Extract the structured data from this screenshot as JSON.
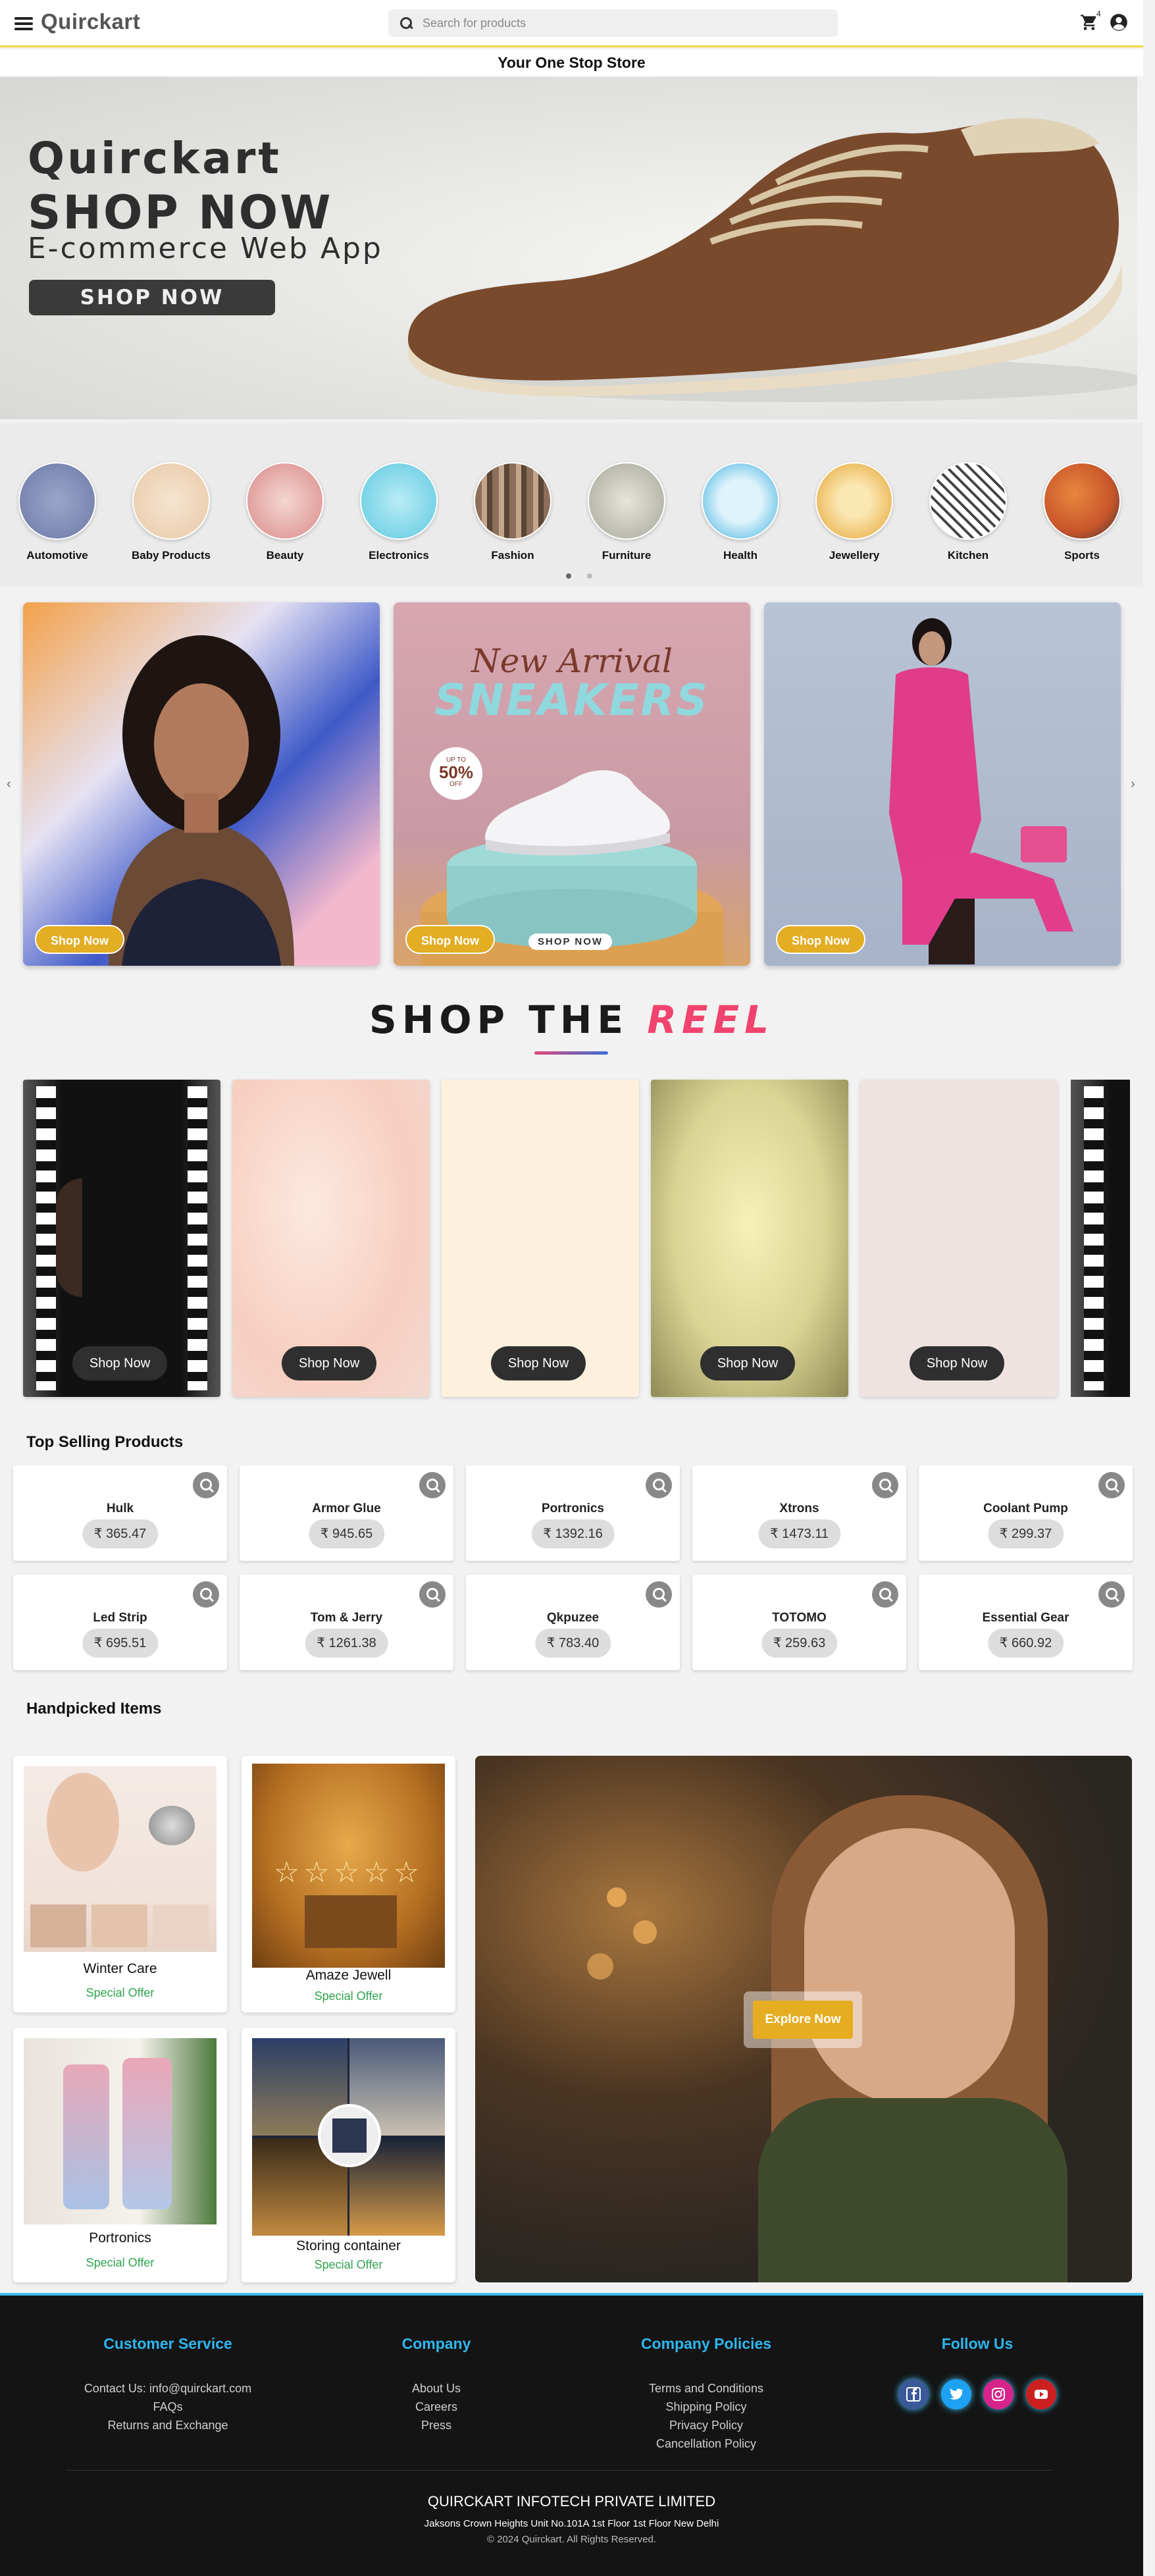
{
  "header": {
    "logo": "Quirckart",
    "search_placeholder": "Search for products",
    "cart_count": "4",
    "tagline": "Your One Stop Store"
  },
  "hero": {
    "title": "Quirckart",
    "subtitle": "SHOP NOW",
    "description": "E-commerce Web App",
    "button": "SHOP NOW"
  },
  "categories": [
    {
      "label": "Automotive",
      "color": "#6c7aa8"
    },
    {
      "label": "Baby Products",
      "color": "#e8c9a8"
    },
    {
      "label": "Beauty",
      "color": "#d98a8a"
    },
    {
      "label": "Electronics",
      "color": "#5fc9e0"
    },
    {
      "label": "Fashion",
      "color": "#8c6e5a"
    },
    {
      "label": "Furniture",
      "color": "#a7a79a"
    },
    {
      "label": "Health",
      "color": "#39aee0"
    },
    {
      "label": "Jewellery",
      "color": "#e3a330"
    },
    {
      "label": "Kitchen",
      "color": "#777777"
    },
    {
      "label": "Sports",
      "color": "#c8552a"
    }
  ],
  "promos": [
    {
      "button": "Shop Now"
    },
    {
      "button": "Shop Now",
      "heading_script": "New Arrival",
      "heading": "SNEAKERS",
      "badge_top": "UP TO",
      "badge_value": "50%",
      "badge_bottom": "OFF",
      "cta": "SHOP NOW"
    },
    {
      "button": "Shop Now"
    }
  ],
  "reel": {
    "title_main": "SHOP THE",
    "title_accent": "REEL",
    "cards": [
      {
        "button": "Shop Now"
      },
      {
        "button": "Shop Now"
      },
      {
        "button": "Shop Now"
      },
      {
        "button": "Shop Now"
      },
      {
        "button": "Shop Now"
      }
    ]
  },
  "top_selling": {
    "title": "Top Selling Products",
    "products": [
      {
        "name": "Hulk",
        "price": "₹ 365.47"
      },
      {
        "name": "Armor Glue",
        "price": "₹ 945.65"
      },
      {
        "name": "Portronics",
        "price": "₹ 1392.16"
      },
      {
        "name": "Xtrons",
        "price": "₹ 1473.11"
      },
      {
        "name": "Coolant Pump",
        "price": "₹ 299.37"
      },
      {
        "name": "Led Strip",
        "price": "₹ 695.51"
      },
      {
        "name": "Tom & Jerry",
        "price": "₹ 1261.38"
      },
      {
        "name": "Qkpuzee",
        "price": "₹ 783.40"
      },
      {
        "name": "TOTOMO",
        "price": "₹ 259.63"
      },
      {
        "name": "Essential Gear",
        "price": "₹ 660.92"
      }
    ]
  },
  "handpicked": {
    "title": "Handpicked Items",
    "items": [
      {
        "name": "Winter Care",
        "offer": "Special Offer"
      },
      {
        "name": "Amaze Jewell",
        "offer": "Special Offer"
      },
      {
        "name": "Portronics",
        "offer": "Special Offer"
      },
      {
        "name": "Storing container",
        "offer": "Special Offer"
      }
    ],
    "explore": "Explore Now"
  },
  "footer": {
    "customer_service": {
      "title": "Customer Service",
      "links": [
        "Contact Us: info@quirckart.com",
        "FAQs",
        "Returns and Exchange"
      ]
    },
    "company": {
      "title": "Company",
      "links": [
        "About Us",
        "Careers",
        "Press"
      ]
    },
    "policies": {
      "title": "Company Policies",
      "links": [
        "Terms and Conditions",
        "Shipping Policy",
        "Privacy Policy",
        "Cancellation Policy"
      ]
    },
    "follow": {
      "title": "Follow Us",
      "icons": [
        "facebook-icon",
        "twitter-icon",
        "instagram-icon",
        "youtube-icon"
      ]
    },
    "company_name": "QUIRCKART INFOTECH PRIVATE LIMITED",
    "address": "Jaksons Crown Heights Unit No.101A 1st Floor 1st Floor New Delhi",
    "copyright": "© 2024 Quirckart. All Rights Reserved."
  }
}
